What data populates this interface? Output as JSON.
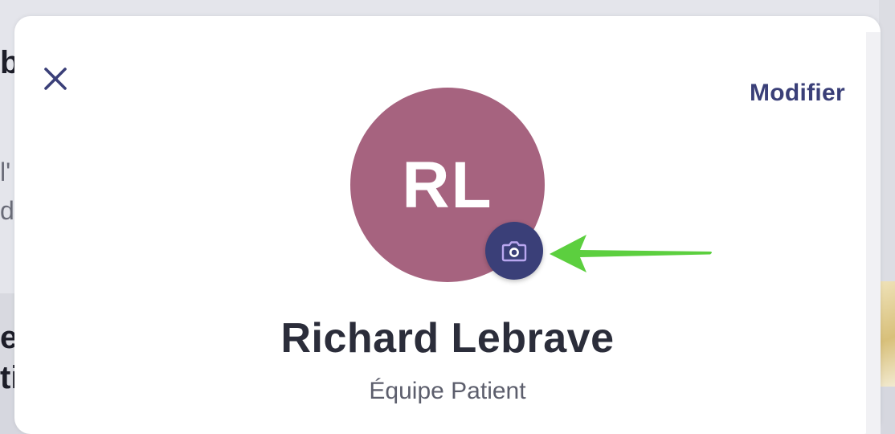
{
  "background": {
    "fragments": [
      "b",
      "l'",
      "d",
      "el",
      "ti"
    ]
  },
  "modal": {
    "edit_label": "Modifier",
    "profile": {
      "initials": "RL",
      "name": "Richard Lebrave",
      "subtitle": "Équipe Patient"
    },
    "icons": {
      "close": "close-icon",
      "camera": "camera-icon",
      "arrow": "arrow-left-icon"
    }
  },
  "colors": {
    "accent": "#3a3f78",
    "avatar_bg": "#a6637f",
    "annotation_arrow": "#5ccf3f",
    "text_dark": "#2b2d3a"
  }
}
